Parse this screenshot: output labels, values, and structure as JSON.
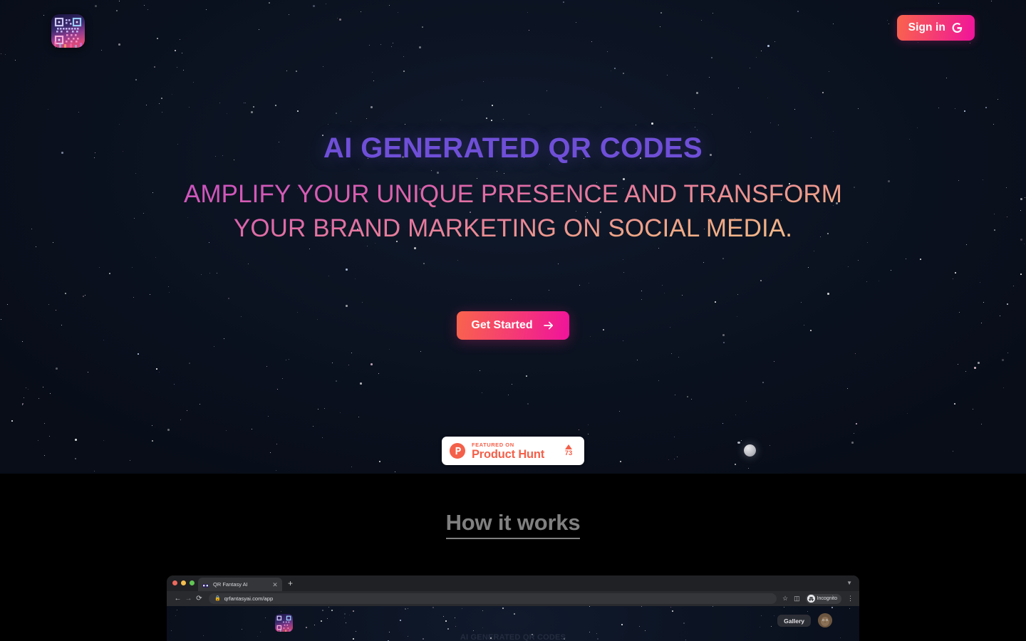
{
  "meta": {
    "page_background": "#000000",
    "hero_background": "#0b1220",
    "accent_purple": "#6f4fd8",
    "accent_pink": "#c84fc6",
    "accent_peach": "#f7c98f",
    "cta_gradient_from": "#f9644c",
    "cta_gradient_to": "#f0139b",
    "product_hunt_color": "#f4604a",
    "how_it_works_color": "#808080"
  },
  "topbar": {
    "logo_name": "qr-fantasy-ai-logo",
    "signin_label": "Sign in",
    "signin_icon": "google-g-icon"
  },
  "hero": {
    "headline": "AI GENERATED QR CODES",
    "subheadline": "AMPLIFY YOUR UNIQUE PRESENCE AND TRANSFORM YOUR BRAND MARKETING ON SOCIAL MEDIA.",
    "cta_label": "Get Started",
    "cta_icon": "arrow-right-icon"
  },
  "product_hunt": {
    "featured_label": "FEATURED ON",
    "name": "Product Hunt",
    "upvote_icon": "triangle-up-icon",
    "upvote_count": "73",
    "logo_icon": "product-hunt-p-icon"
  },
  "how_it_works": {
    "title": "How it works"
  },
  "browser_mockup": {
    "window_controls": [
      "close",
      "minimize",
      "maximize"
    ],
    "tab": {
      "title": "QR Fantasy AI",
      "favicon": "qr-code-favicon",
      "close_icon": "close-icon"
    },
    "new_tab_icon": "plus-icon",
    "tabstrip_chevron": "chevron-down-icon",
    "toolbar": {
      "back_icon": "arrow-left-icon",
      "forward_icon": "arrow-right-icon",
      "reload_icon": "reload-icon",
      "lock_icon": "lock-icon",
      "url": "qrfantasyai.com/app",
      "bookmark_icon": "star-icon",
      "split_icon": "split-view-icon",
      "incognito_label": "Incognito",
      "menu_icon": "kebab-menu-icon"
    },
    "content": {
      "logo_name": "qr-fantasy-ai-logo",
      "gallery_label": "Gallery",
      "avatar_name": "user-avatar",
      "headline": "AI GENERATED QR CODES"
    }
  }
}
